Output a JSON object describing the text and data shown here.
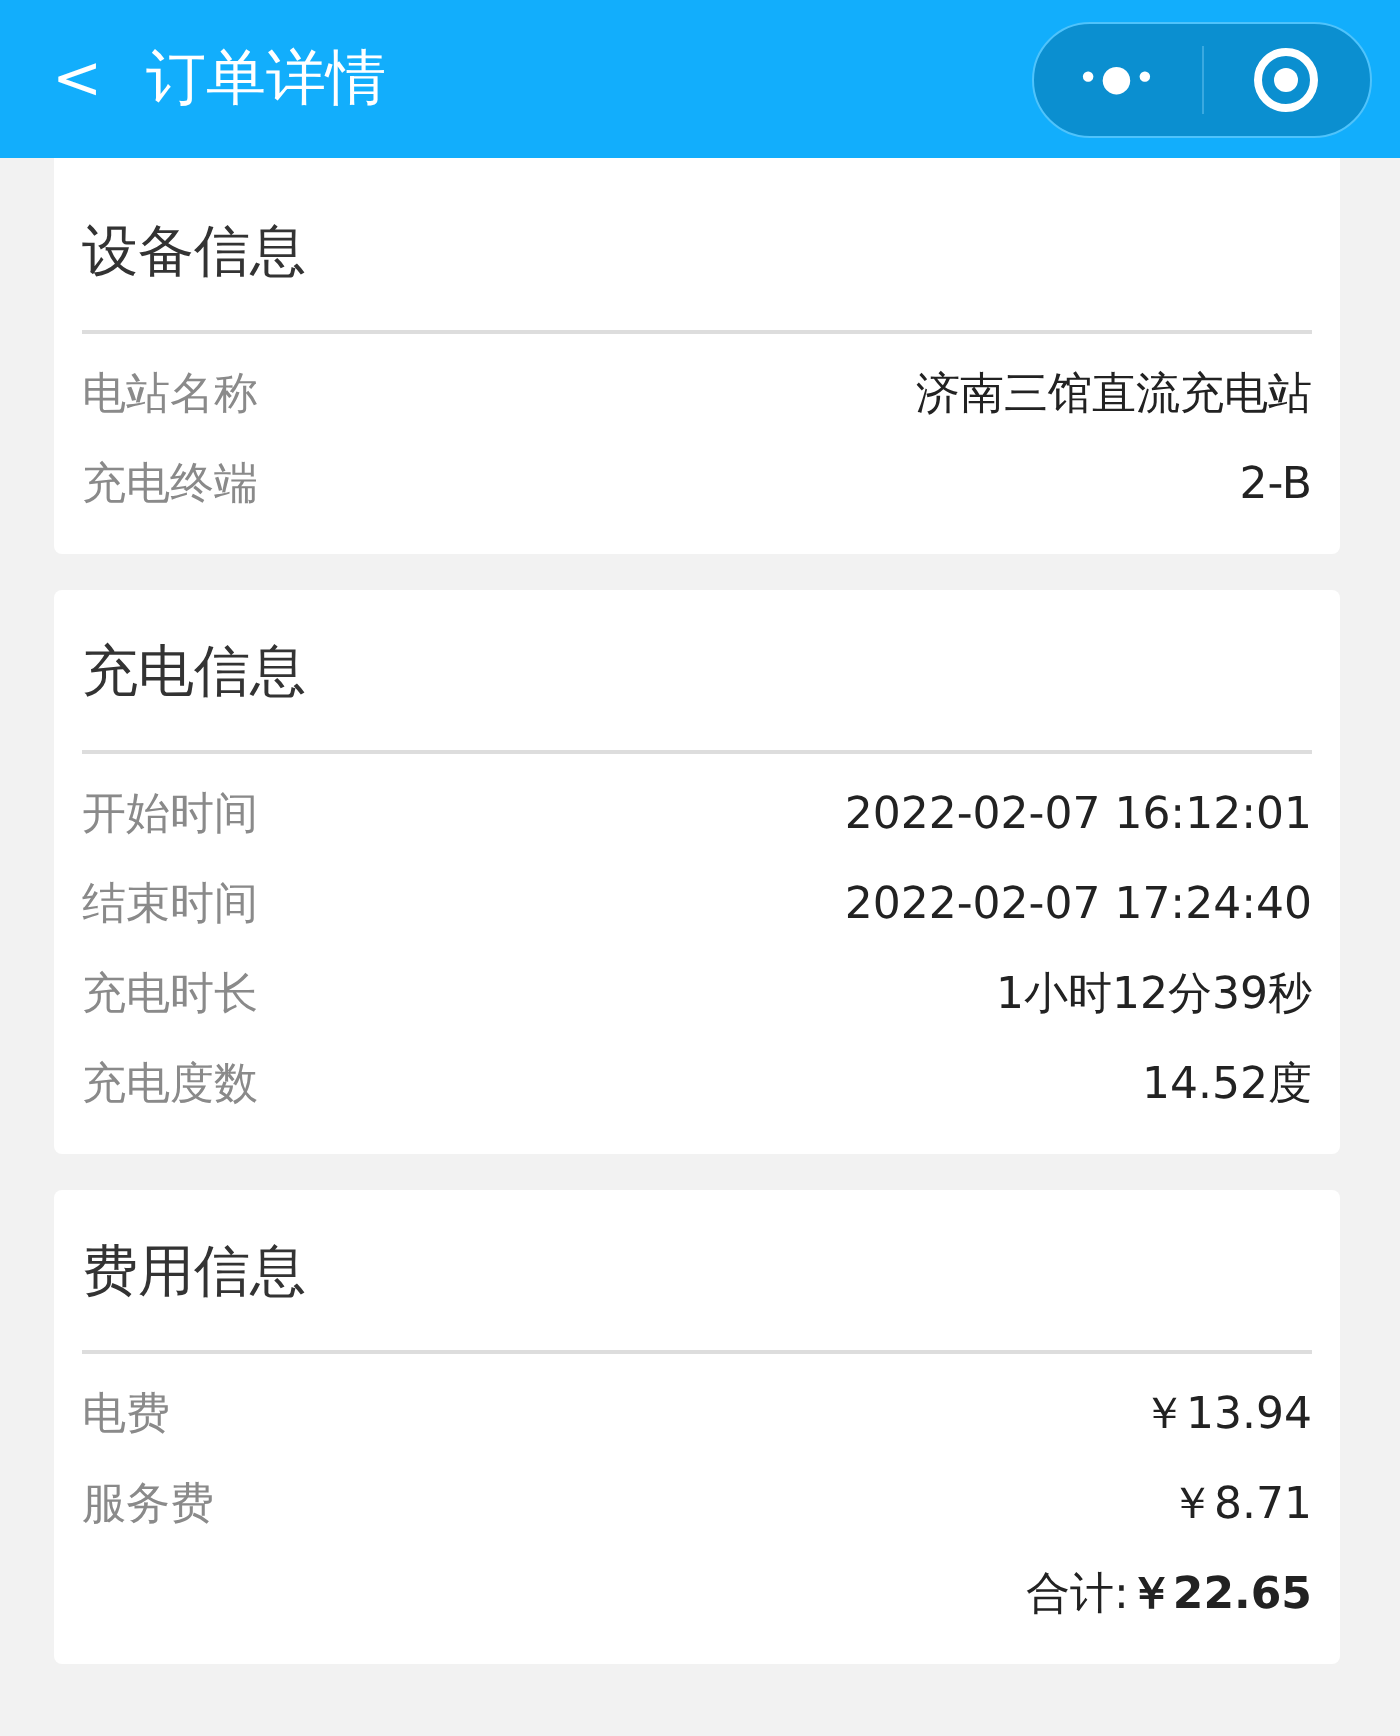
{
  "header": {
    "back": "<",
    "title": "订单详情",
    "more": "•●•"
  },
  "sections": [
    {
      "title": "设备信息",
      "rows": [
        {
          "label": "电站名称",
          "value": "济南三馆直流充电站"
        },
        {
          "label": "充电终端",
          "value": "2-B"
        }
      ]
    },
    {
      "title": "充电信息",
      "rows": [
        {
          "label": "开始时间",
          "value": "2022-02-07 16:12:01"
        },
        {
          "label": "结束时间",
          "value": "2022-02-07 17:24:40"
        },
        {
          "label": "充电时长",
          "value": "1小时12分39秒"
        },
        {
          "label": "充电度数",
          "value": "14.52度"
        }
      ]
    },
    {
      "title": "费用信息",
      "rows": [
        {
          "label": "电费",
          "value": "￥13.94"
        },
        {
          "label": "服务费",
          "value": "￥8.71"
        }
      ],
      "total": "合计:**￥22.65**"
    }
  ]
}
